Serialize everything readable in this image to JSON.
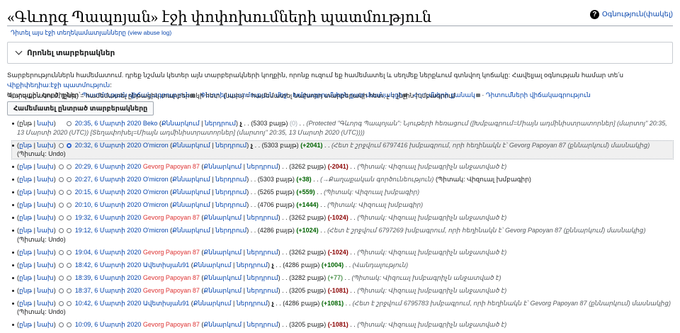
{
  "header": {
    "title": "«Գևորգ Պապոյան» էջի փոփոխումների պատմություն",
    "help_label": "Օգնություն(փակել)"
  },
  "subtitle": {
    "view_log": "Դիտել այս էջի տեղեկամատյանները",
    "view_abuse": "(view abuse log)"
  },
  "filter": {
    "label": "Որոնել տարբերակներ"
  },
  "info": {
    "line1": "Տարբերություններն համեմատում. դրեք նշման կետեր այն տարբերակների կողքին, որոնք ուզում եք համեմատել և սեղմեք ներքևում գտնվող կոճակը: Հավելյալ օգնության համար տե՛ս ",
    "line1_link": "Վիքիփեդիա:էջի պատմություն",
    "line2_prefix": "Արտաքին գործիքներ՝ ",
    "tools": [
      "Պատմության վիճակագրություն",
      "Փնտրել պատմության մեջ",
      "Խմբագրումներն ըստ մասնակցի",
      "Հղումների քանակ",
      "Դիտումների վիճակագրություն"
    ]
  },
  "legend": "Պարզաբանում. (ընթ) = համեմատել ընթացիկ տարբերակի հետ, (նախ) = համեմատել նախորդ տարբերակի հետ, չ = չնչին խմբագրում",
  "compare_button": "Համեմատել ընտրած տարբերակները",
  "labels": {
    "cur": "ընթ",
    "prev": "նախ",
    "talk": "Քննարկում",
    "contribs": "ներդրում"
  },
  "revisions": [
    {
      "date": "20:35, 6 Մարտի 2020",
      "user": "Beko",
      "minor": true,
      "size": "(5303 բայթ)",
      "diff": "(0)",
      "diff_type": "zero",
      "comment": "(Protected \"Գևորգ Պապոյան\": Նյութերի հեռացում ([Խմբագրում=Միայն ադմինիստրատորներ] (մարտոյ\" 20:35, 13 Մարտի 2020 (UTC)) [Տեղափոխել=Միայն ադմինիստրատորներ] (մարտոյ\" 20:35, 13 Մարտի 2020 (UTC))))",
      "cur_link": false,
      "prev_link": true,
      "user_red": false
    },
    {
      "date": "20:32, 6 Մարտի 2020",
      "user": "O'micron",
      "minor": true,
      "size": "(5303 բայթ)",
      "diff": "(+2041)",
      "diff_type": "pos",
      "comment": "(Հետ է շրջվում 6797416 խմբագրում, որի հեղինակն է՝ Gevorg Papoyan 87 (քննարկում) մասնակից)",
      "tail": "(Պիտակ: Undo)",
      "cur_link": true,
      "prev_link": true,
      "user_red": false
    },
    {
      "date": "20:29, 6 Մարտի 2020",
      "user": "Gevorg Papoyan 87",
      "minor": false,
      "size": "(3262 բայթ)",
      "diff": "(-2041)",
      "diff_type": "neg",
      "comment": "(Պիտակ: Վիզուալ խմբագրիչն անջատված է)",
      "cur_link": true,
      "prev_link": true,
      "user_red": true
    },
    {
      "date": "20:27, 6 Մարտի 2020",
      "user": "O'micron",
      "minor": false,
      "size": "(5303 բայթ)",
      "diff": "(+38)",
      "diff_type": "pos",
      "comment": "(→Քաղաքական գործունեություն)",
      "tail": "(Պիտակ: Վիզուալ խմբագիր)",
      "cur_link": true,
      "prev_link": true,
      "user_red": false
    },
    {
      "date": "20:15, 6 Մարտի 2020",
      "user": "O'micron",
      "minor": false,
      "size": "(5265 բայթ)",
      "diff": "(+559)",
      "diff_type": "pos",
      "comment": "(Պիտակ: Վիզուալ խմբագիր)",
      "cur_link": true,
      "prev_link": true,
      "user_red": false
    },
    {
      "date": "20:10, 6 Մարտի 2020",
      "user": "O'micron",
      "minor": false,
      "size": "(4706 բայթ)",
      "diff": "(+1444)",
      "diff_type": "pos",
      "comment": "(Պիտակ: Վիզուալ խմբագիր)",
      "cur_link": true,
      "prev_link": true,
      "user_red": false
    },
    {
      "date": "19:32, 6 Մարտի 2020",
      "user": "Gevorg Papoyan 87",
      "minor": false,
      "size": "(3262 բայթ)",
      "diff": "(-1024)",
      "diff_type": "neg",
      "comment": "(Պիտակ: Վիզուալ խմբագրիչն անջատված է)",
      "cur_link": true,
      "prev_link": true,
      "user_red": true
    },
    {
      "date": "19:12, 6 Մարտի 2020",
      "user": "O'micron",
      "minor": false,
      "size": "(4286 բայթ)",
      "diff": "(+1024)",
      "diff_type": "pos",
      "comment": "(Հետ է շրջվում 6797269 խմբագրում, որի հեղինակն է՝ Gevorg Papoyan 87 (քննարկում) մասնակից)",
      "tail": "(Պիտակ: Undo)",
      "cur_link": true,
      "prev_link": true,
      "user_red": false
    },
    {
      "date": "19:04, 6 Մարտի 2020",
      "user": "Gevorg Papoyan 87",
      "minor": false,
      "size": "(3262 բայթ)",
      "diff": "(-1024)",
      "diff_type": "neg",
      "comment": "(Պիտակ: Վիզուալ խմբագրիչն անջատված է)",
      "cur_link": true,
      "prev_link": true,
      "user_red": true
    },
    {
      "date": "18:42, 6 Մարտի 2020",
      "user": "Ավետիսյան91",
      "minor": true,
      "size": "(4286 բայթ)",
      "diff": "(+1004)",
      "diff_type": "pos",
      "comment": "(Վանդալություն)",
      "cur_link": true,
      "prev_link": true,
      "user_red": false
    },
    {
      "date": "18:39, 6 Մարտի 2020",
      "user": "Gevorg Papoyan 87",
      "minor": false,
      "size": "(3282 բայթ)",
      "diff": "(+77)",
      "diff_type": "posl",
      "comment": "(Պիտակ: Վիզուալ խմբագրիչն անջատված է)",
      "cur_link": true,
      "prev_link": true,
      "user_red": true
    },
    {
      "date": "18:37, 6 Մարտի 2020",
      "user": "Gevorg Papoyan 87",
      "minor": false,
      "size": "(3205 բայթ)",
      "diff": "(-1081)",
      "diff_type": "neg",
      "comment": "(Պիտակ: Վիզուալ խմբագրիչն անջատված է)",
      "cur_link": true,
      "prev_link": true,
      "user_red": true
    },
    {
      "date": "10:42, 6 Մարտի 2020",
      "user": "Ավետիսյան91",
      "minor": true,
      "size": "(4286 բայթ)",
      "diff": "(+1081)",
      "diff_type": "pos",
      "comment": "(Հետ է շրջվում 6795783 խմբագրում, որի հեղինակն է՝ Gevorg Papoyan 87 (քննարկում) մասնակից)",
      "tail": "(Պիտակ: Undo)",
      "cur_link": true,
      "prev_link": true,
      "user_red": false
    },
    {
      "date": "10:09, 6 Մարտի 2020",
      "user": "Gevorg Papoyan 87",
      "minor": false,
      "size": "(3205 բայթ)",
      "diff": "(-1081)",
      "diff_type": "neg",
      "comment": "(Պիտակ: Վիզուալ խմբագրիչն անջատված է)",
      "cur_link": true,
      "prev_link": true,
      "user_red": true
    }
  ]
}
